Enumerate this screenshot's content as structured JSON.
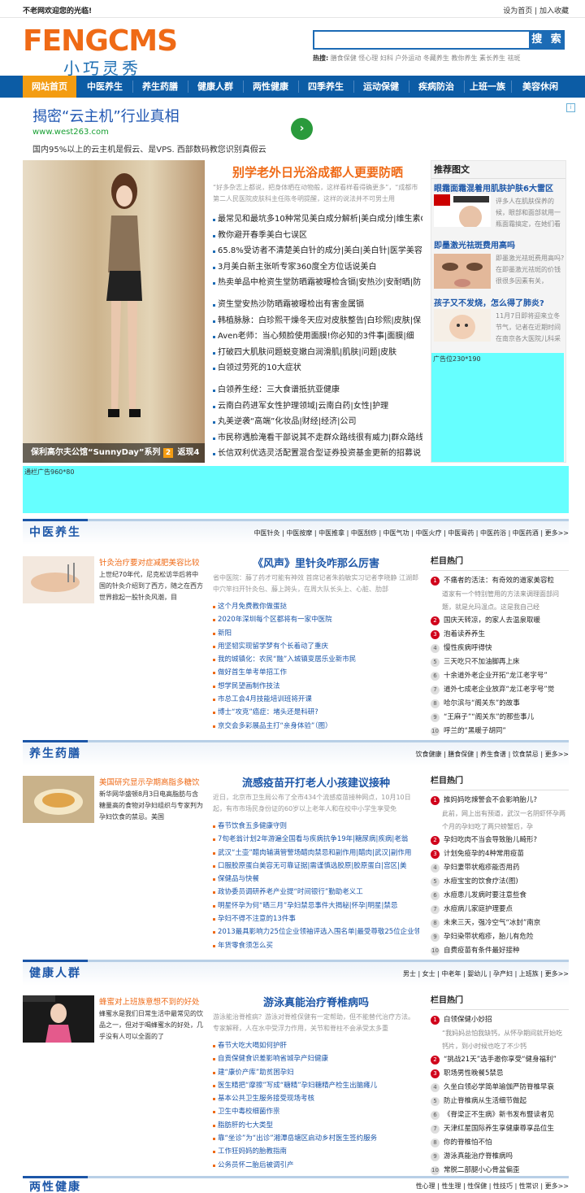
{
  "topbar": {
    "welcome": "不老网欢迎您的光临!",
    "links": "设为首页 | 加入收藏"
  },
  "logo": {
    "main": "FENGCMS",
    "sub": "小巧灵秀"
  },
  "search": {
    "button": "搜 索",
    "hot_label": "热搜:",
    "hot_words": "膳食保健 怪心理 妇科 户外运动 冬藏养生 教你养生 素长养生 祛斑"
  },
  "nav": [
    "网站首页",
    "中医养生",
    "养生药膳",
    "健康人群",
    "两性健康",
    "四季养生",
    "运动保健",
    "疾病防治",
    "上班一族",
    "美容休闲"
  ],
  "ad_top": {
    "title": "揭密“云主机”行业真相",
    "url": "www.west263.com",
    "desc": "国内95%以上的云主机是假云、是VPS. 西部数码教您识别真假云"
  },
  "focus": {
    "caption": "保利高尔夫公馆“SunnyDay”系列",
    "num1": "2",
    "caption2": "返现4"
  },
  "feature": {
    "headline": "别学老外日光浴成都人更要防晒",
    "summary": "“好多杂志上都说，把身体晒在动物般，这样看样看得确更多”，“成都市第二人民医院皮肤科主任陈冬明提醒，这样的说法并不可男士用",
    "list1": [
      "最常见和最坑多10种常见美白成分解析|美白成分|维生素C",
      "教你避开春季美白七误区",
      "65.8%受访者不清楚美白针的成分|美白|美白针|医学美容",
      "3月美白新主张听专家360度全方位话说美白",
      "热卖单品中枪资生堂防晒霜被曝检含镉|安热沙|安耐晒|防"
    ],
    "list2": [
      "资生堂安热沙防晒霜被曝检出有害金属镉",
      "韩植脉脉：白珍熙干燥冬天应对皮肤整告|白珍熙|皮肤|保",
      "Aven老师：当心频脸使用面膜!你必知的3件事|面膜|细",
      "打破四大肌肤问题蜕变嫩白润滑肌|肌肤|问题|皮肤",
      "白领过劳死的10大症状"
    ],
    "list3": [
      "白领养生经：三大食谱抵抗亚健康",
      "云南白药进军女性护理领域|云南白药|女性|护理",
      "丸美逆袭“高端”化妆品|财经|经济|公司",
      "市民称遇脸淹看干部说其不走群众路线很有威力|群众路线|",
      "长信双利优选灵活配置混合型证券投资基金更新的招募说"
    ]
  },
  "recommend": {
    "title": "推荐图文",
    "items": [
      {
        "title": "眼霜面霜混着用肌肤护肤6大雷区",
        "desc": "评多人在肌肤保养的候，眼部和面部就用一瓶面霜搞定，在她们看"
      },
      {
        "title": "即墨激光祛斑费用高吗",
        "desc": "即墨激光祛斑费用高吗? 在即墨激光祛斑的价钱很很多因素有关，"
      },
      {
        "title": "孩子又不发烧，怎么得了肺炎?",
        "desc": "11月7日即将迎来立冬节气，记者在近期时间在南京各大医院儿科采访"
      }
    ],
    "ad": "广告位230*190"
  },
  "ad_mid": "通栏广告960*80",
  "sections": [
    {
      "title": "中医养生",
      "tabs": "中医针灸 | 中医按摩 | 中医推拿 | 中医刮痧 | 中医气功 | 中医火疗 | 中医膏药 | 中医药浴 | 中医药酒 | 更多>>",
      "side_title": "针灸治疗要对症减肥美容比较",
      "side_desc": "上世纪70年代，尼克松访华后将中国的针灸介绍到了西方，随之在西方世界掀起一股针灸风潮，目",
      "main_title": "《风声》里针灸咋那么厉害",
      "main_sum": "省中医院：藤了药才可能有神效 首席记者朱韵敏实习记者李晓静 江湖郎中穴竿扫开针灸包、藤上跨头，在周大队长头上、心脏、肋部",
      "list": [
        "这个月免费教你做蛋挞",
        "2020年深圳每个区都将有一家中医院",
        "新阳",
        "用坚韧实现留学梦有个长着动了重庆",
        "我的城镇化：农民“融”入城镇变居乐业新市民",
        "做好首生单考单招工作",
        "想学民望画制作技法",
        "市总工会4月技能培训班将开课",
        "博士“攻克”癌症：堵头还是科研?",
        "京交会多彩展品主打“亲身体验”（图）"
      ],
      "hot_title": "栏目热门",
      "hot_first": "不痛者的活法：有奇效的道家美容粒",
      "hot_first_desc": "道家有一个特别管用的方法来调理面部问题，就是允玛温点。这是我自己经",
      "hot": [
        "国庆天转凉，的家人去温泉取暖",
        "泡着读养养生",
        "慢性疾病呼得快",
        "三天吃只不加油脚再上床",
        "十余道外老企业开拓“龙江老字号”",
        "道外七成老企业放弃“龙江老字号”觉",
        "哈尔滨与“阁关东”的故事",
        "“王麻子”“阁关东”的那些事儿",
        "呼兰的“黑暖子胡同”"
      ]
    },
    {
      "title": "养生药膳",
      "tabs": "饮食健康 | 膳食保健 | 养生食谱 | 饮食禁忌 | 更多>>",
      "side_title": "美国研究显示孕期高脂多糖饮",
      "side_desc": "新华网华盛顿8月3日电高脂肪与含糖量高的食物对孕妇组织与专家判为孕妇饮食的禁忌。美国",
      "main_title": "流感疫苗开打老人小孩建议接种",
      "main_sum": "近日，北京市卫生局公布了全市434个流感疫苗接种网点，10月10日起，有市市场民身份证的60岁以上老年人和在校中小学生享受免",
      "list": [
        "春节饮食五多健康守则",
        "7旬老翁计划2年游遍全国看与疾病抗争19年|糖尿病|疾病|老翁",
        "武汉“土壶”醋肉辅满管警场醋肉禁忌和副作用|醋肉|武汉|副作用",
        "口服胶原蛋白美容无可靠证据|需谨慎选胶原|胶原蛋白|宫区|美",
        "保健品与快餐",
        "政协委员调研养老产业提“时间银行”勤助老义工",
        "明星怀孕为何“晒三月”孕妇禁忌事件大揭秘|怀孕|明星|禁忌",
        "孕妇不得不注意的13件事",
        "2013最具影响力25位企业领袖评选入围名单|最受尊敬25位企业领",
        "年货零食须怎么买"
      ],
      "hot_title": "栏目热门",
      "hot_first": "推妈妈吃辣警会不会影响胎儿?",
      "hot_first_desc": "此前，网上出有预道，武汉一名阴虾怀孕两个月的孕妇吃了两只螃蟹后，孕",
      "hot": [
        "孕妇吃肉不当会导致胎儿畸形?",
        "计划免疫孕的4种常用疫苗",
        "孕妇妻带状疱疹能否用药",
        "水痘宝宝的饮食疗法(图)",
        "水痘患儿发病时要注意些食",
        "水痘病儿家庭护理要点",
        "未来三天，强冷空气“冰封”南京",
        "孕妇染带状疱疹，胎儿有危险",
        "自费疫苗有条件最好接种"
      ]
    },
    {
      "title": "健康人群",
      "tabs": "男士 | 女士 | 中老年 | 婴幼儿 | 孕产妇 | 上班族 | 更多>>",
      "side_title": "蜂蜜对上班族意想不到的好处",
      "side_desc": "蜂蜜水是我们日常生活中最常见的饮品之一，但对于喝蜂蜜水的好处，几乎没有人可以全面的了",
      "main_title": "游泳真能治疗脊椎病吗",
      "main_sum": "游泳能治脊椎病？游泳对脊椎保健有一定帮助，但不能替代治疗方法。专家解释，人在水中受浮力作用，关节和脊柱不会承受太多重",
      "list": [
        "春节大吃大喝如何护肝",
        "自贡保健食识差影响省城孕产妇健康",
        "建“康价产库”助贫困孕妇",
        "医生精把“摩擦”写成“糖精”孕妇糖精产检生出脑瘫儿",
        "基本公共卫生服务接受现场考核",
        "卫生中毒校细菌作祟",
        "脂肪肝的七大类型",
        "靠“坐诊”为“出诊”湘潭岳塘区启动乡村医生签约服务",
        "工作狂妈妈的胎教指南",
        "公务员怀二胎后被调引产"
      ],
      "hot_title": "栏目热门",
      "hot_first": "白领保健小妙招",
      "hot_first_desc": "“我妈妈总怕我缺钙，从怀孕期间就开始吃钙片，到小时候也吃了不少钙",
      "hot": [
        "“挑战21天”选手邀你享受“健身福利”",
        "职场男性晚餐5禁忌",
        "久坐白领必学简单瑜伽严防脊椎早衰",
        "防止脊椎病从生活细节做起",
        "《脊梁正不生病》新书发布暨读者见",
        "天津红星国际养生享健康尊享品位生",
        "你的脊椎怕不怕",
        "游泳真能治疗脊椎病吗",
        "常脱二部腿小心骨盆偏歪"
      ]
    }
  ],
  "bottom": {
    "title": "两性健康",
    "tabs": "性心理 | 性生理 | 性保健 | 性技巧 | 性常识 | 更多>>"
  }
}
